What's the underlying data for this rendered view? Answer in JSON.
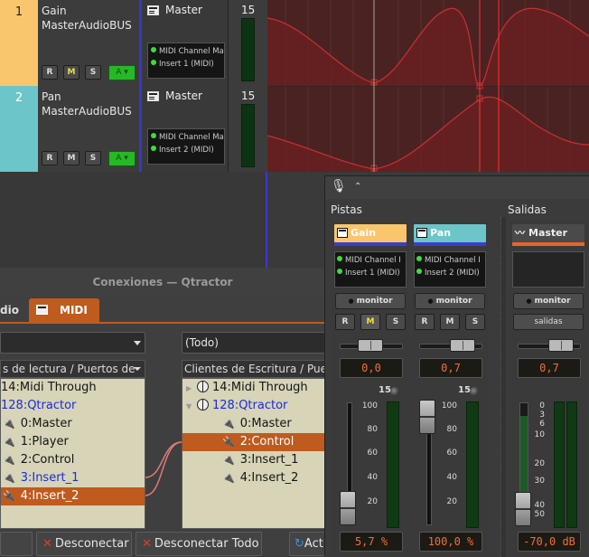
{
  "tracks": [
    {
      "number": "1",
      "name": "Gain",
      "bus": "MasterAudioBUS",
      "output": "Master",
      "plugins": [
        "MIDI Channel Ma",
        "Insert 1 (MIDI)"
      ],
      "meter": "15",
      "color": "#f9c66d"
    },
    {
      "number": "2",
      "name": "Pan",
      "bus": "MasterAudioBUS",
      "output": "Master",
      "plugins": [
        "MIDI Channel Ma",
        "Insert 2 (MIDI)"
      ],
      "meter": "15",
      "color": "#6cc5c9"
    }
  ],
  "track_buttons": {
    "r": "R",
    "m": "M",
    "s": "S",
    "arm": "A"
  },
  "connections": {
    "title": "Conexiones — Qtractor",
    "tab_audio": "dio",
    "tab_midi": "MIDI",
    "left_combo": "",
    "right_combo": "(Todo)",
    "left_header": "s de lectura / Puertos de",
    "right_header": "Clientes de Escritura / Pue",
    "left_items": [
      {
        "label": "14:Midi Through",
        "type": "client"
      },
      {
        "label": "128:Qtractor",
        "type": "client-blue"
      },
      {
        "label": "0:Master",
        "type": "port"
      },
      {
        "label": "1:Player",
        "type": "port"
      },
      {
        "label": "2:Control",
        "type": "port"
      },
      {
        "label": "3:Insert_1",
        "type": "port-blue"
      },
      {
        "label": "4:Insert_2",
        "type": "port-selected"
      }
    ],
    "right_items": [
      {
        "label": "14:Midi Through",
        "type": "client"
      },
      {
        "label": "128:Qtractor",
        "type": "client-blue"
      },
      {
        "label": "0:Master",
        "type": "port"
      },
      {
        "label": "2:Control",
        "type": "port-selected"
      },
      {
        "label": "3:Insert_1",
        "type": "port"
      },
      {
        "label": "4:Insert_2",
        "type": "port"
      }
    ],
    "buttons": {
      "disconnect": "Desconectar",
      "disconnect_all": "Desconectar Todo",
      "refresh": "Act"
    }
  },
  "mixer": {
    "section_tracks": "Pistas",
    "section_outputs": "Salidas",
    "strips": [
      {
        "name": "Gain",
        "color": "#f9c66d",
        "underline": "#3c3ccf",
        "plugins": [
          "MIDI Channel I",
          "Insert 1 (MIDI)"
        ],
        "monitor": "monitor",
        "pan_value": "0,0",
        "meter": "15",
        "gain_value": "5,7 %",
        "pan_position": 0.5,
        "fader_level": 0.057
      },
      {
        "name": "Pan",
        "color": "#6cc5c9",
        "underline": "#3c3ccf",
        "plugins": [
          "MIDI Channel I",
          "Insert 2 (MIDI)"
        ],
        "monitor": "monitor",
        "pan_value": "0,7",
        "meter": "15",
        "gain_value": "100,0 %",
        "pan_position": 0.85,
        "fader_level": 1.0
      }
    ],
    "output": {
      "name": "Master",
      "underline": "#e8642a",
      "monitor": "monitor",
      "route": "salidas",
      "pan_value": "0,7",
      "gain_value": "-70,0 dB",
      "pan_position": 0.85
    },
    "scale_midi": [
      "100",
      "80",
      "60",
      "40",
      "20"
    ],
    "scale_db": [
      "0",
      "3",
      "6",
      "10",
      "20",
      "30",
      "40",
      "50"
    ],
    "buttons": {
      "r": "R",
      "m": "M",
      "s": "S"
    }
  }
}
